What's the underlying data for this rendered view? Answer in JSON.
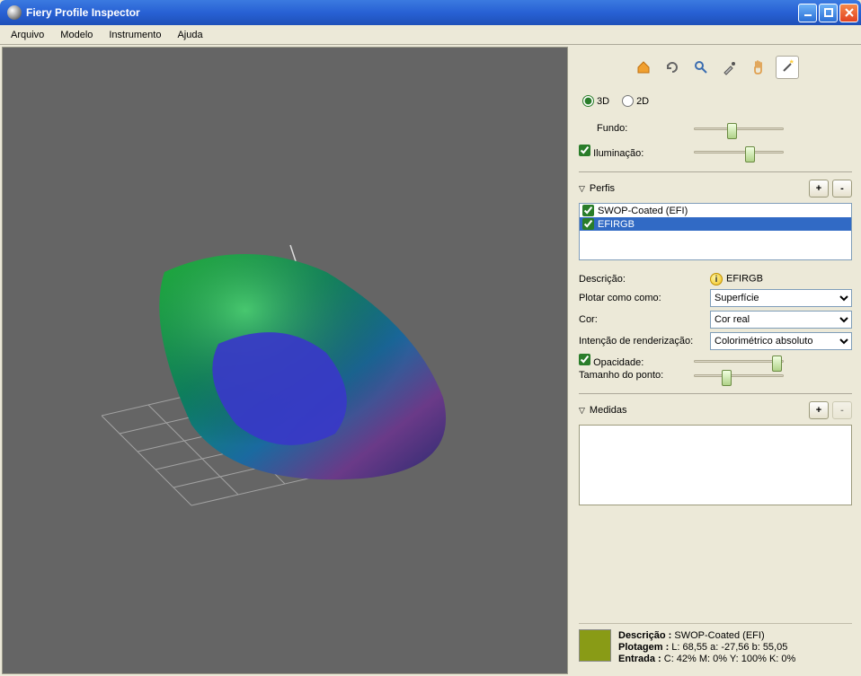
{
  "window": {
    "title": "Fiery Profile Inspector"
  },
  "menu": {
    "arquivo": "Arquivo",
    "modelo": "Modelo",
    "instrumento": "Instrumento",
    "ajuda": "Ajuda"
  },
  "view": {
    "mode_3d": "3D",
    "mode_2d": "2D",
    "fundo": "Fundo:",
    "iluminacao": "Iluminação:"
  },
  "perfis": {
    "title": "Perfis",
    "items": [
      {
        "label": "SWOP-Coated (EFI)",
        "checked": true,
        "selected": false
      },
      {
        "label": "EFIRGB",
        "checked": true,
        "selected": true
      }
    ]
  },
  "props": {
    "descricao_label": "Descrição:",
    "descricao_value": "EFIRGB",
    "plotar_label": "Plotar como como:",
    "plotar_value": "Superfície",
    "cor_label": "Cor:",
    "cor_value": "Cor real",
    "intencao_label": "Intenção de renderização:",
    "intencao_value": "Colorimétrico absoluto",
    "opacidade_label": "Opacidade:",
    "tamanho_label": "Tamanho do ponto:"
  },
  "medidas": {
    "title": "Medidas"
  },
  "status": {
    "descricao_label": "Descrição :",
    "descricao_value": "SWOP-Coated (EFI)",
    "plotagem_label": "Plotagem :",
    "plotagem_value": "L: 68,55  a: -27,56  b: 55,05",
    "entrada_label": "Entrada :",
    "entrada_value": "C: 42%   M:   0%   Y: 100%   K:   0%",
    "swatch_color": "#899b16"
  }
}
